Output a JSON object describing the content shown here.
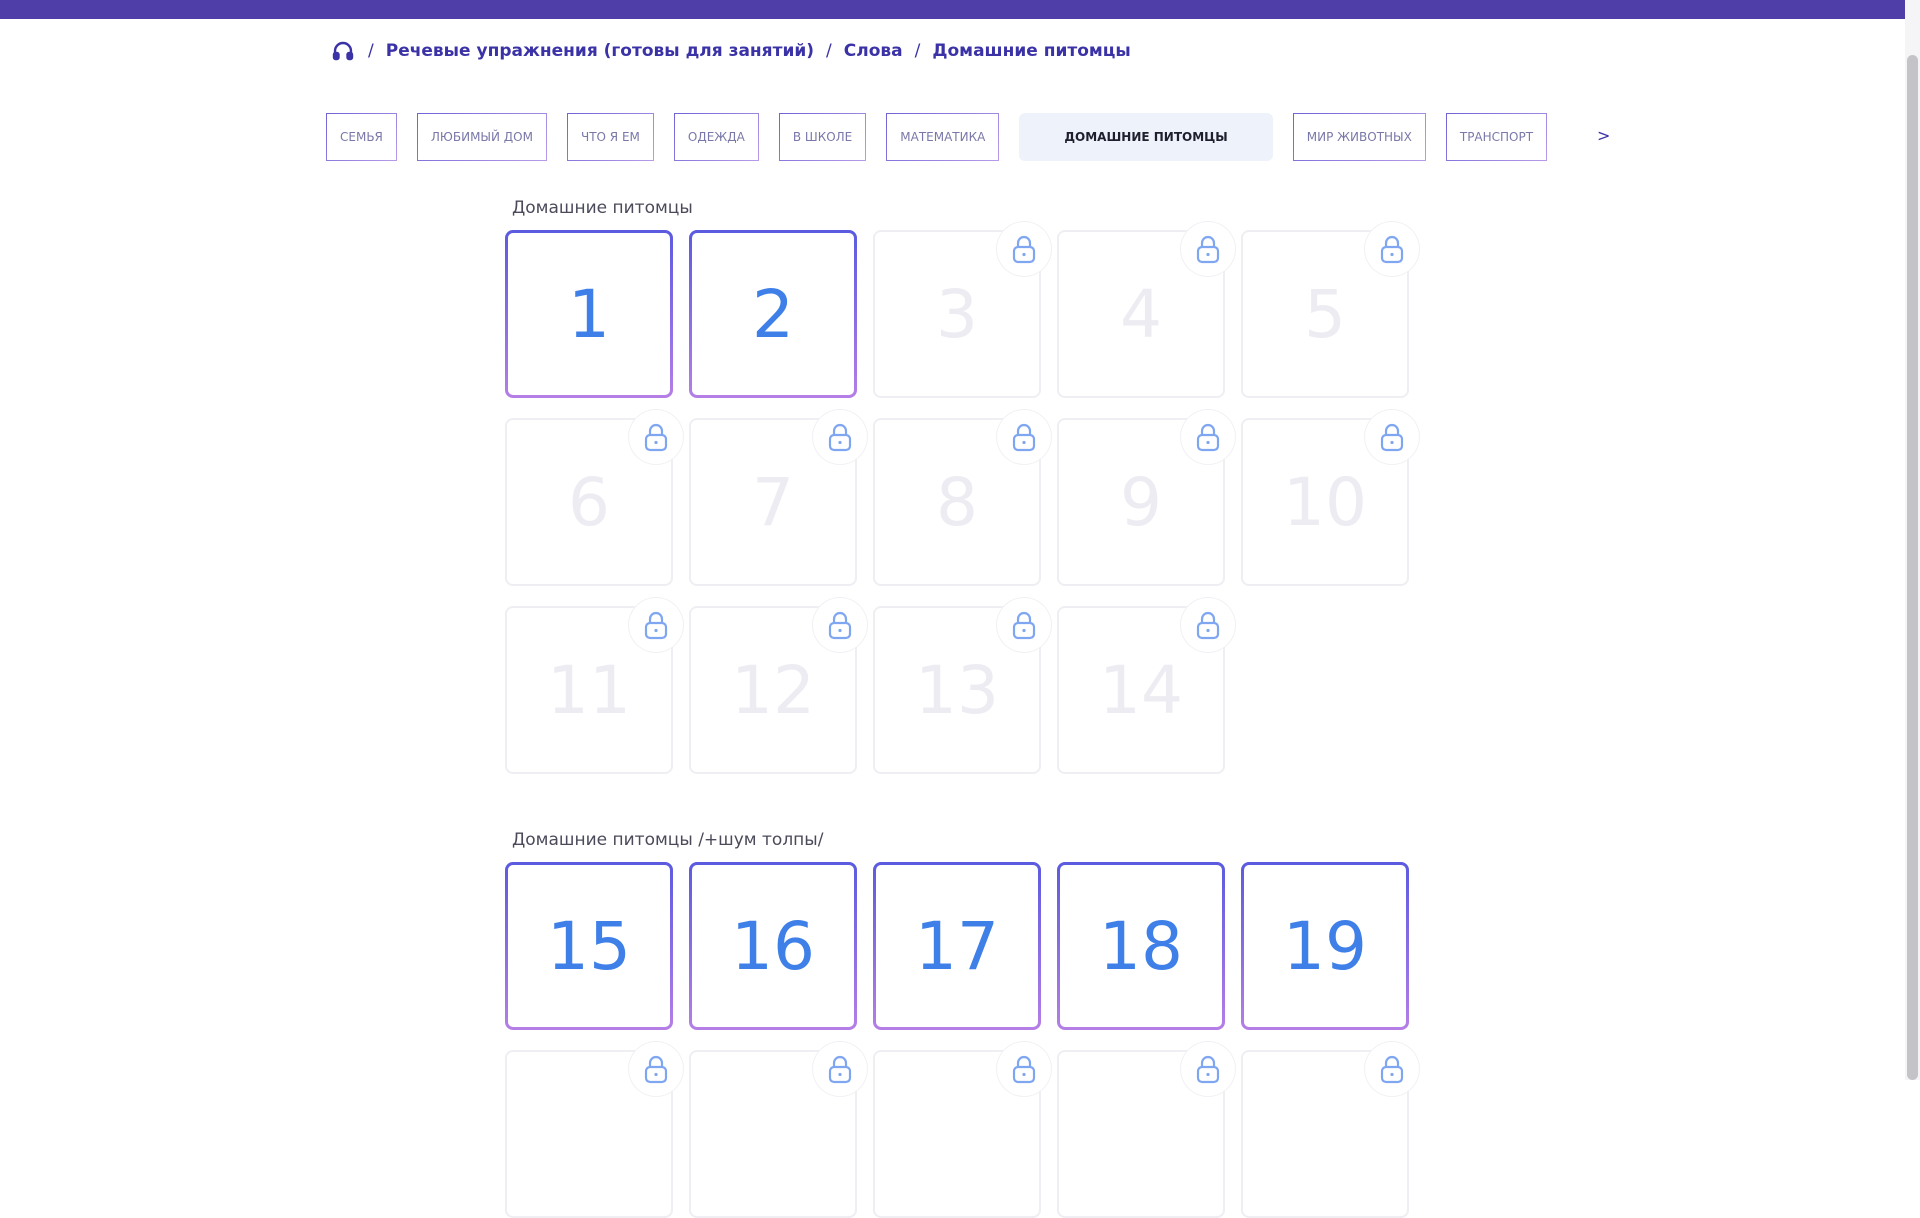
{
  "breadcrumb": {
    "items": [
      "Речевые упражнения (готовы для занятий)",
      "Слова",
      "Домашние питомцы"
    ],
    "separator": "/"
  },
  "tabs": {
    "items": [
      {
        "label": "СЕМЬЯ"
      },
      {
        "label": "ЛЮБИМЫЙ ДОМ"
      },
      {
        "label": "ЧТО Я ЕМ"
      },
      {
        "label": "ОДЕЖДА"
      },
      {
        "label": "В ШКОЛЕ"
      },
      {
        "label": "МАТЕМАТИКА"
      },
      {
        "label": "ДОМАШНИЕ ПИТОМЦЫ",
        "active": true
      },
      {
        "label": "МИР ЖИВОТНЫХ"
      },
      {
        "label": "ТРАНСПОРТ"
      }
    ],
    "next_label": ">"
  },
  "sections": [
    {
      "title": "Домашние питомцы",
      "cards": [
        {
          "n": "1",
          "locked": false
        },
        {
          "n": "2",
          "locked": false
        },
        {
          "n": "3",
          "locked": true
        },
        {
          "n": "4",
          "locked": true
        },
        {
          "n": "5",
          "locked": true
        },
        {
          "n": "6",
          "locked": true
        },
        {
          "n": "7",
          "locked": true
        },
        {
          "n": "8",
          "locked": true
        },
        {
          "n": "9",
          "locked": true
        },
        {
          "n": "10",
          "locked": true
        },
        {
          "n": "11",
          "locked": true
        },
        {
          "n": "12",
          "locked": true
        },
        {
          "n": "13",
          "locked": true
        },
        {
          "n": "14",
          "locked": true
        }
      ]
    },
    {
      "title": "Домашние питомцы /+шум толпы/",
      "cards": [
        {
          "n": "15",
          "locked": false
        },
        {
          "n": "16",
          "locked": false
        },
        {
          "n": "17",
          "locked": false
        },
        {
          "n": "18",
          "locked": false
        },
        {
          "n": "19",
          "locked": false
        },
        {
          "n": "",
          "locked": true
        },
        {
          "n": "",
          "locked": true
        },
        {
          "n": "",
          "locked": true
        },
        {
          "n": "",
          "locked": true
        },
        {
          "n": "",
          "locked": true
        }
      ]
    }
  ],
  "colors": {
    "topbar": "#4f3ea8",
    "accent": "#3f80e8",
    "breadcrumb": "#3a32a6",
    "lock": "#7fa6f0"
  },
  "icons": {
    "home": "headphones-icon",
    "lock": "lock-icon"
  }
}
